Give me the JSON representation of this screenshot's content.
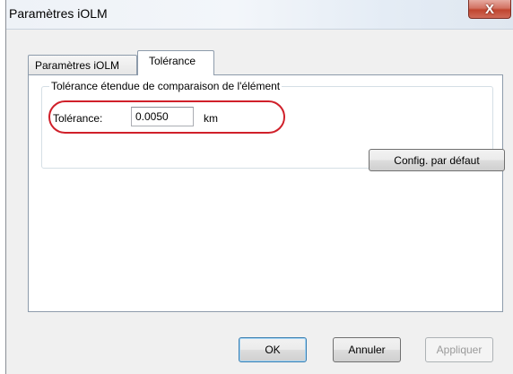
{
  "window": {
    "title": "Paramètres iOLM",
    "close_glyph": "X"
  },
  "tabs": [
    {
      "label": "Paramètres iOLM",
      "selected": false
    },
    {
      "label": "Tolérance",
      "selected": true
    }
  ],
  "group": {
    "legend": "Tolérance étendue de comparaison de l'élément",
    "field_label": "Tolérance:",
    "field_value": "0.0050",
    "unit": "km",
    "default_button": "Config. par défaut"
  },
  "footer": {
    "ok": "OK",
    "cancel": "Annuler",
    "apply": "Appliquer",
    "apply_enabled": false
  },
  "colors": {
    "highlight": "#d0202a",
    "close_button": "#c0452f"
  }
}
